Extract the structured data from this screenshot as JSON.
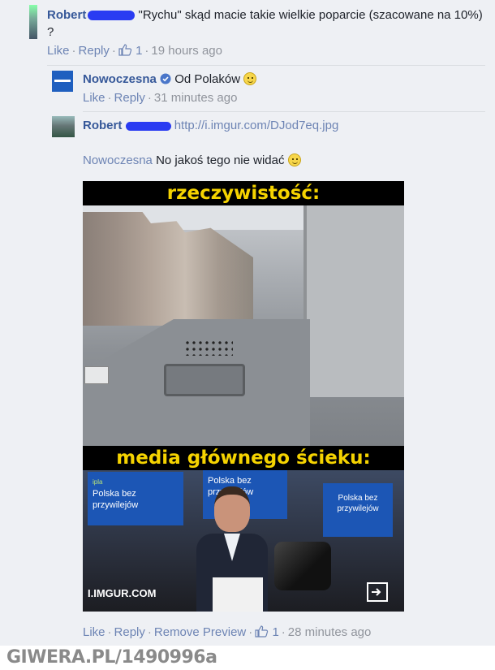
{
  "comments": [
    {
      "author": "Robert",
      "text": "\"Rychu\" skąd macie takie wielkie poparcie (szacowane na 10%) ?",
      "actions": {
        "like": "Like",
        "reply": "Reply",
        "likes": "1",
        "time": "19 hours ago"
      }
    },
    {
      "author": "Nowoczesna",
      "text": "Od Polaków",
      "actions": {
        "like": "Like",
        "reply": "Reply",
        "time": "31 minutes ago"
      }
    },
    {
      "author": "Robert",
      "link": "http://i.imgur.com/DJod7eq.jpg",
      "mention": "Nowoczesna",
      "text": "No jakoś tego nie widać",
      "actions": {
        "like": "Like",
        "reply": "Reply",
        "remove_preview": "Remove Preview",
        "likes": "1",
        "time": "28 minutes ago"
      }
    }
  ],
  "preview": {
    "top_caption": "rzeczywistość:",
    "bottom_caption": "media głównego ścieku:",
    "sign_text_1": "Polska bez przywilejów",
    "sign_text_2": "Polska bez przywilejów",
    "sign_text_3": "Polska bez przywilejów",
    "sign_brand": "ipla",
    "watermark": "I.IMGUR.COM"
  },
  "footer": "GIWERA.PL/1490996a",
  "colors": {
    "link": "#365899",
    "action": "#6d84b4",
    "meta": "#90949c",
    "caption": "#f5d300",
    "panel": "#eef0f4"
  }
}
